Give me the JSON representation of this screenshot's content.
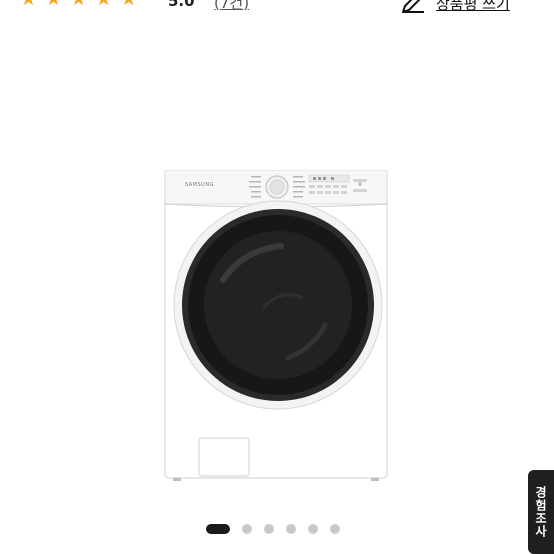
{
  "rating": {
    "stars": 5,
    "score": "5.0",
    "reviews": "(7건)"
  },
  "actions": {
    "write_review": "상품평 쓰기"
  },
  "product": {
    "brand": "SAMSUNG"
  },
  "gallery": {
    "count": 6,
    "active": 0
  },
  "survey": {
    "label": "경험조사"
  }
}
